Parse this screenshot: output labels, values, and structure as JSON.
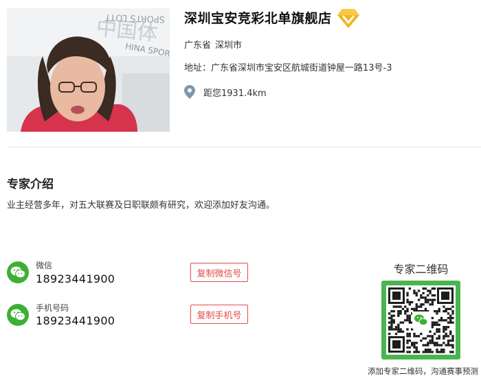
{
  "store": {
    "name": "深圳宝安竞彩北单旗舰店",
    "badge_icon": "vip-diamond-icon",
    "province": "广东省",
    "city": "深圳市",
    "address": "地址：广东省深圳市宝安区航城街道钟屋一路13号-3",
    "distance": "距您1931.4km",
    "photo_sign_text": [
      "中国体",
      "SPORTS LOTT",
      "HINA SPORTS"
    ]
  },
  "expert": {
    "section_title": "专家介绍",
    "intro": "业主经营多年，对五大联赛及日职联颇有研究，欢迎添加好友沟通。"
  },
  "contacts": {
    "wechat": {
      "label": "微信",
      "value": "18923441900",
      "button": "复制微信号"
    },
    "phone": {
      "label": "手机号码",
      "value": "18923441900",
      "button": "复制手机号"
    }
  },
  "qr": {
    "title": "专家二维码",
    "caption": "添加专家二维码，沟通赛事预测"
  },
  "colors": {
    "accent_red": "#e44a4a",
    "wechat_green": "#3cb034",
    "badge_gold": "#f2b41c"
  }
}
